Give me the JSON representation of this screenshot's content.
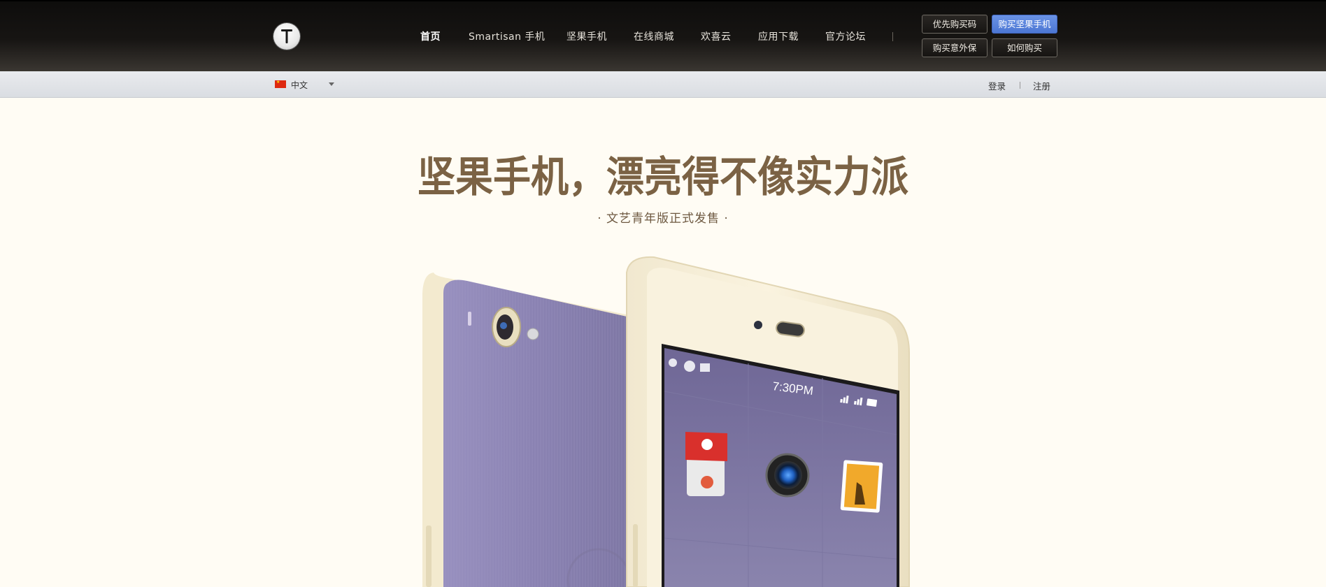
{
  "brand": {
    "logo_letter": "T"
  },
  "nav": {
    "items": [
      {
        "label": "首页",
        "active": true
      },
      {
        "label": "Smartisan 手机",
        "active": false
      },
      {
        "label": "坚果手机",
        "active": false
      },
      {
        "label": "在线商城",
        "active": false
      },
      {
        "label": "欢喜云",
        "active": false
      },
      {
        "label": "应用下载",
        "active": false
      },
      {
        "label": "官方论坛",
        "active": false
      }
    ],
    "buttons": {
      "priority_code": "优先购买码",
      "buy_nut": "购买坚果手机",
      "buy_insurance": "购买意外保",
      "how_to_buy": "如何购买"
    }
  },
  "subbar": {
    "language": "中文",
    "login": "登录",
    "register": "注册"
  },
  "hero": {
    "headline": "坚果手机，漂亮得不像实力派",
    "subline": "· 文艺青年版正式发售 ·",
    "phone_time": "7:30PM"
  },
  "colors": {
    "accent_blue": "#5b84de",
    "headline_brown": "#7b6244",
    "phone_purple": "#8e86b4",
    "phone_body": "#f6efd9"
  }
}
